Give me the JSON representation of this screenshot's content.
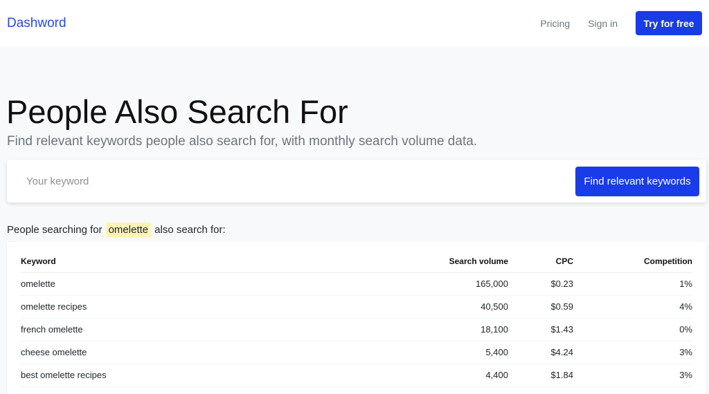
{
  "navbar": {
    "brand": "Dashword",
    "links": [
      {
        "label": "Pricing"
      },
      {
        "label": "Sign in"
      }
    ],
    "cta": "Try for free"
  },
  "hero": {
    "title": "People Also Search For",
    "subtitle": "Find relevant keywords people also search for, with monthly search volume data."
  },
  "search": {
    "placeholder": "Your keyword",
    "value": "",
    "button_label": "Find relevant keywords"
  },
  "results": {
    "prefix": "People searching for",
    "keyword": "omelette",
    "suffix": "also search for:",
    "columns": [
      "Keyword",
      "Search volume",
      "CPC",
      "Competition"
    ],
    "rows": [
      {
        "keyword": "omelette",
        "volume": "165,000",
        "cpc": "$0.23",
        "competition": "1%"
      },
      {
        "keyword": "omelette recipes",
        "volume": "40,500",
        "cpc": "$0.59",
        "competition": "4%"
      },
      {
        "keyword": "french omelette",
        "volume": "18,100",
        "cpc": "$1.43",
        "competition": "0%"
      },
      {
        "keyword": "cheese omelette",
        "volume": "5,400",
        "cpc": "$4.24",
        "competition": "3%"
      },
      {
        "keyword": "best omelette recipes",
        "volume": "4,400",
        "cpc": "$1.84",
        "competition": "3%"
      }
    ]
  },
  "colors": {
    "brand": "#2747e6",
    "primary_button": "#1a3be8",
    "highlight": "#fff3b8"
  }
}
